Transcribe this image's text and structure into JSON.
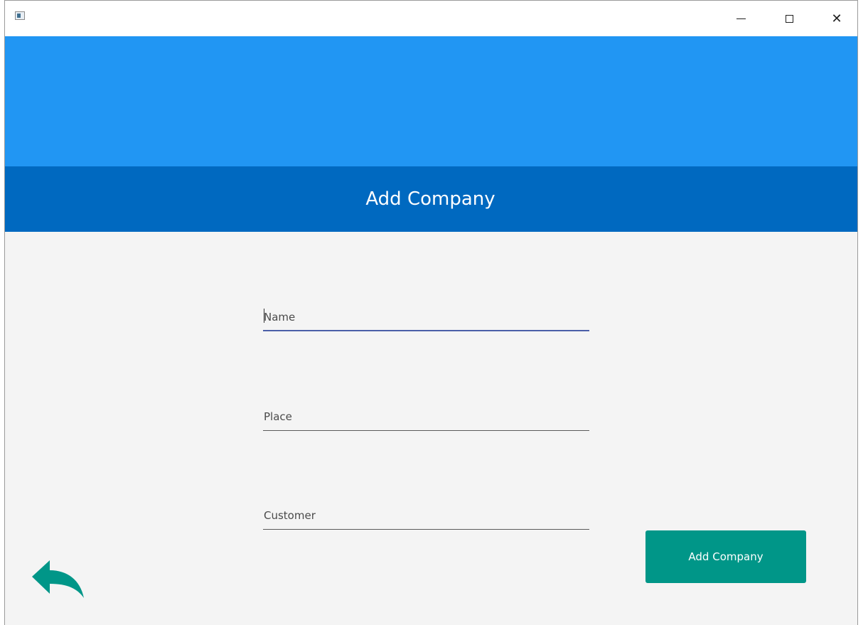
{
  "window": {
    "controls": {
      "minimize_icon": "minimize-icon",
      "maximize_icon": "maximize-icon",
      "close_icon": "close-icon",
      "close_glyph": "✕"
    }
  },
  "header": {
    "title": "Add Company"
  },
  "form": {
    "fields": [
      {
        "placeholder": "Name",
        "value": ""
      },
      {
        "placeholder": "Place",
        "value": ""
      },
      {
        "placeholder": "Customer",
        "value": ""
      }
    ],
    "submit_label": "Add Company"
  },
  "colors": {
    "top_band": "#2196f3",
    "header_bar": "#0069c0",
    "accent_button": "#009688",
    "focus_underline": "#4a5ea8"
  },
  "icons": {
    "back": "back-arrow-icon"
  }
}
